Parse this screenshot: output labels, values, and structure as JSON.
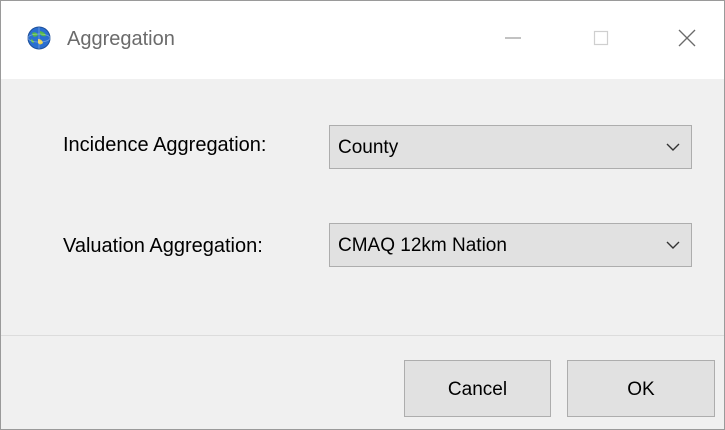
{
  "window": {
    "title": "Aggregation"
  },
  "form": {
    "incidence_label": "Incidence Aggregation:",
    "incidence_value": "County",
    "valuation_label": "Valuation Aggregation:",
    "valuation_value": "CMAQ 12km Nation"
  },
  "buttons": {
    "cancel": "Cancel",
    "ok": "OK"
  },
  "icons": {
    "app": "globe-icon",
    "minimize": "minimize-icon",
    "maximize": "maximize-icon",
    "close": "close-icon",
    "dropdown": "chevron-down-icon"
  },
  "colors": {
    "accent": "#2a6fd0",
    "window_bg": "#f0f0f0",
    "button_bg": "#e1e1e1"
  }
}
